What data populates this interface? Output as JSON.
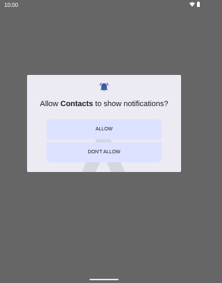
{
  "status_bar": {
    "time": "10:00",
    "icons": [
      "wifi-icon",
      "battery-icon"
    ]
  },
  "dialog": {
    "icon": "notification-bell-icon",
    "title_prefix": "Allow ",
    "app_name": "Contacts",
    "title_suffix": " to show notifications?",
    "allow_label": "ALLOW",
    "deny_label": "DON'T ALLOW",
    "accent_color": "#3c5aa6",
    "button_color": "#dce2ff"
  }
}
